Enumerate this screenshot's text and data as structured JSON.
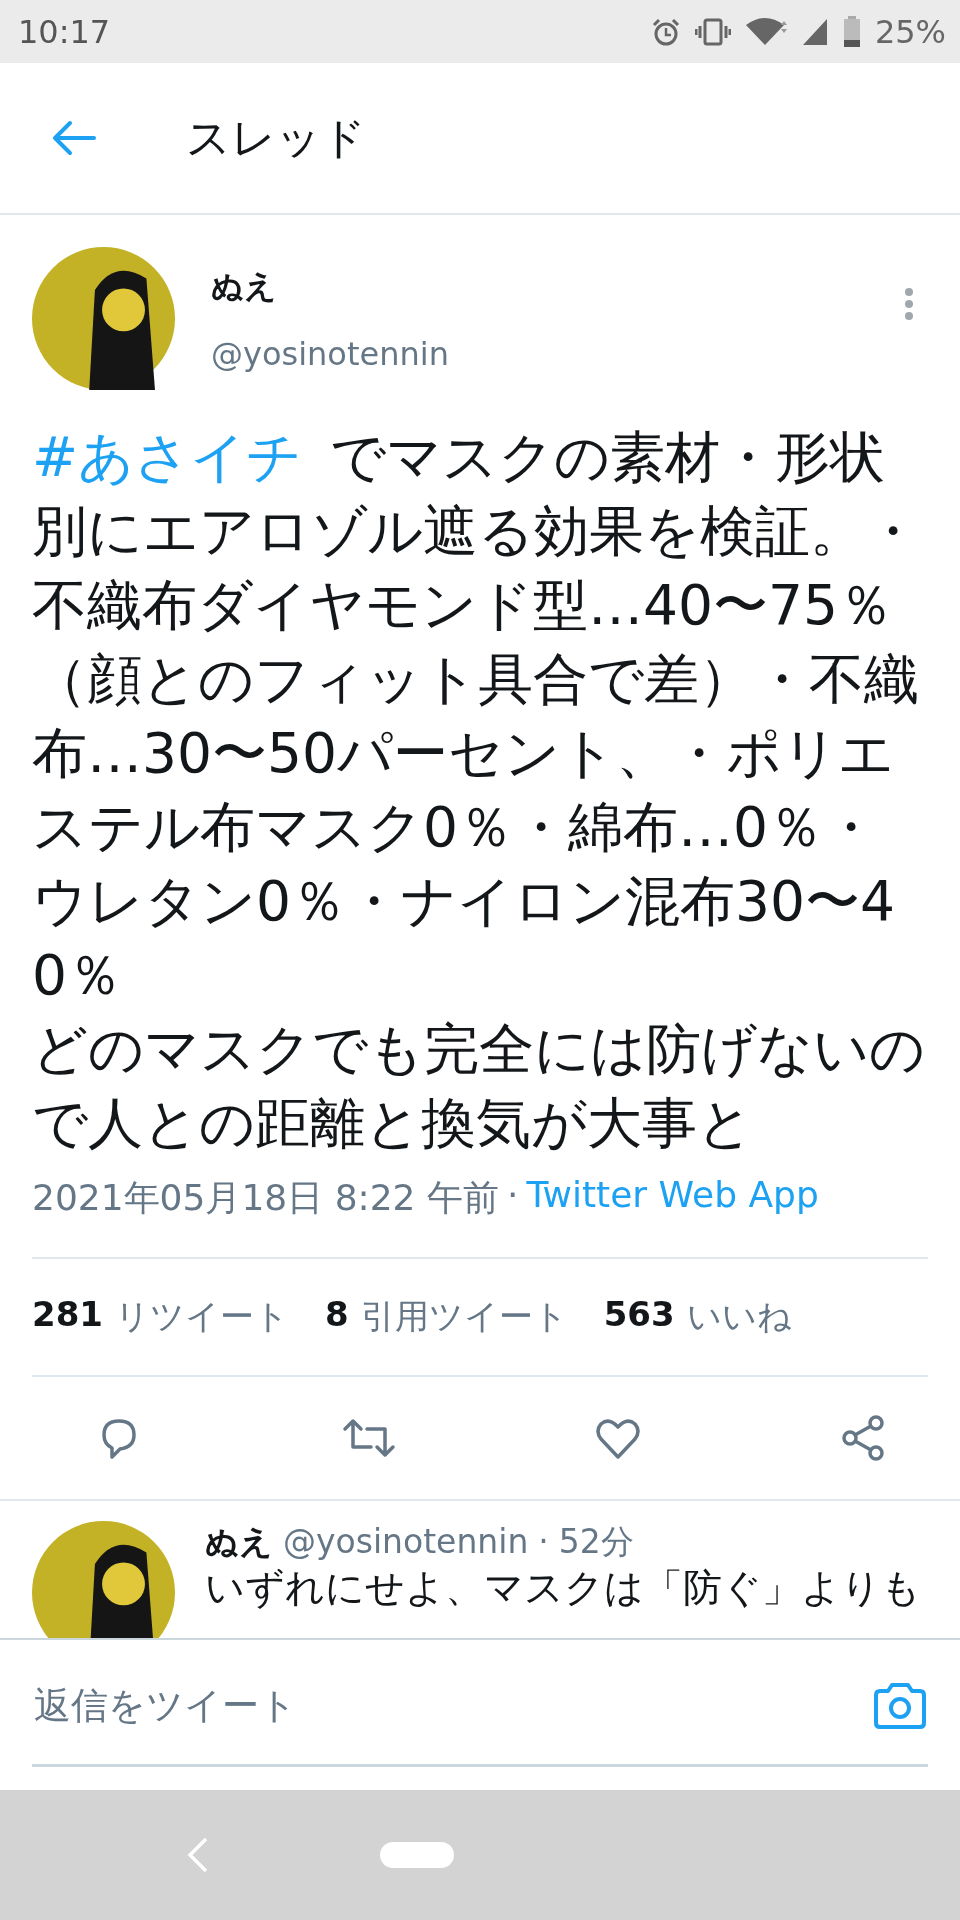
{
  "status_bar": {
    "time": "10:17",
    "battery": "25%"
  },
  "header": {
    "title": "スレッド"
  },
  "tweet": {
    "name": "ぬえ",
    "handle": "@yosinotennin",
    "hashtag": "#あさイチ",
    "paragraphs": [
      "でマスクの素材・形状別にエアロゾル遮る効果を検証。・不織布ダイヤモンド型…40〜75％（顔とのフィット具合で差）・不織布…30〜50パーセント、・ポリエステル布マスク0％・綿布…0％・ウレタン0％・ナイロン混布30〜40％",
      "どのマスクでも完全には防げないので人との距離と換気が大事と"
    ],
    "timestamp": "2021年05月18日 8:22 午前",
    "separator": "·",
    "source": "Twitter Web App",
    "stats": [
      {
        "count": "281",
        "label": "リツイート"
      },
      {
        "count": "8",
        "label": "引用ツイート"
      },
      {
        "count": "563",
        "label": "いいね"
      }
    ]
  },
  "reply": {
    "name": "ぬえ",
    "handle": "@yosinotennin",
    "separator": "·",
    "time": "52分",
    "text": "いずれにせよ、マスクは「防ぐ」よりも"
  },
  "composer": {
    "placeholder": "返信をツイート"
  }
}
